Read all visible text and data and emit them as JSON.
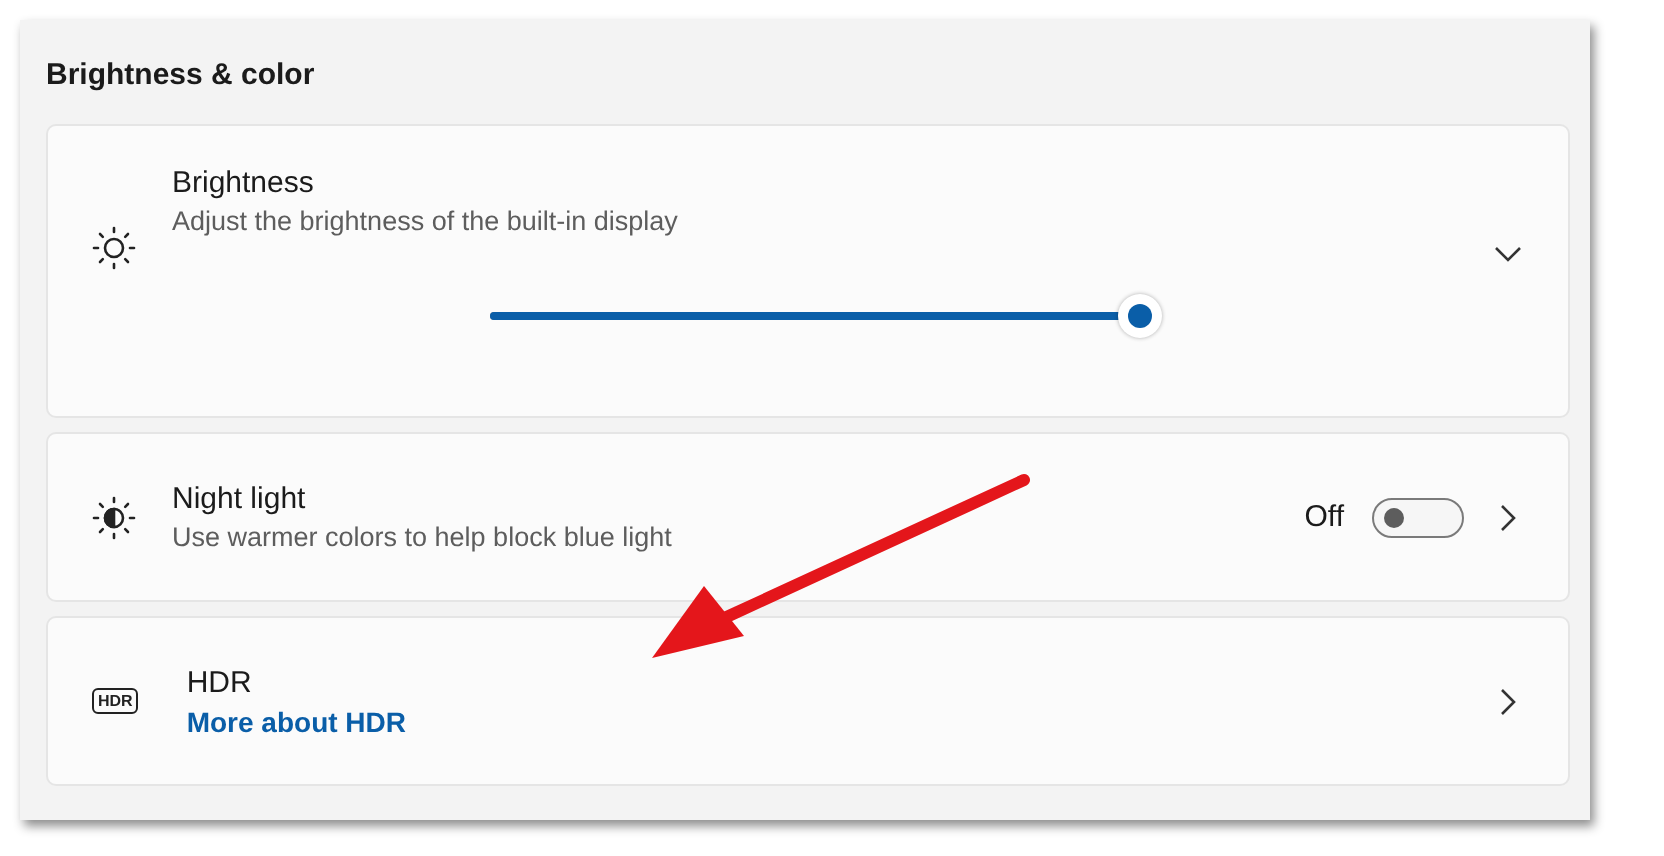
{
  "section": {
    "title": "Brightness & color"
  },
  "brightness": {
    "title": "Brightness",
    "description": "Adjust the brightness of the built-in display",
    "expanded": false,
    "level": 1.0
  },
  "night_light": {
    "title": "Night light",
    "description": "Use warmer colors to help block blue light",
    "state_text": "Off",
    "on": false
  },
  "hdr": {
    "icon_text": "HDR",
    "title": "HDR",
    "link": "More about HDR"
  },
  "annotation": {
    "kind": "arrow"
  }
}
